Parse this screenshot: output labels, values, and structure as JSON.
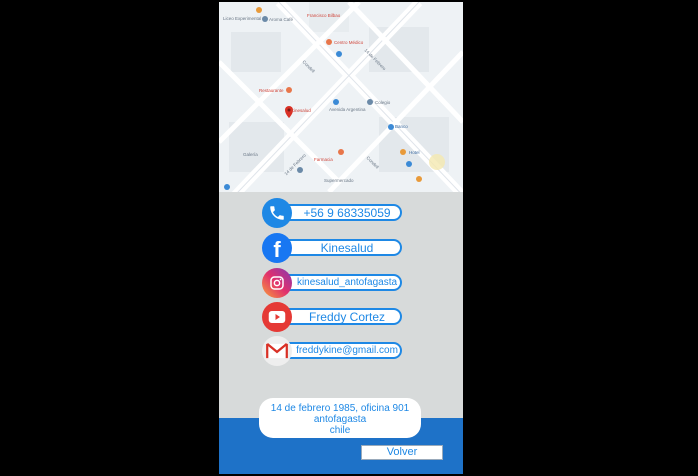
{
  "map": {
    "labels": [
      {
        "text": "Liceo Experimental",
        "tone": "gray"
      },
      {
        "text": "Aroma Café",
        "tone": "gray"
      },
      {
        "text": "Universidad",
        "tone": "gray"
      },
      {
        "text": "Francisco Bilbao",
        "tone": "gray"
      },
      {
        "text": "Centro Médico",
        "tone": "red"
      },
      {
        "text": "Avenida Argentina",
        "tone": "gray"
      },
      {
        "text": "Restaurante",
        "tone": "red"
      },
      {
        "text": "Kinesalud",
        "tone": "red"
      },
      {
        "text": "14 de Febrero",
        "tone": "gray"
      },
      {
        "text": "Colegio",
        "tone": "gray"
      },
      {
        "text": "Banco",
        "tone": "blue"
      },
      {
        "text": "Farmacia",
        "tone": "red"
      },
      {
        "text": "Galería",
        "tone": "gray"
      },
      {
        "text": "Condell",
        "tone": "gray"
      },
      {
        "text": "Hotel",
        "tone": "blue"
      },
      {
        "text": "Supermercado",
        "tone": "gray"
      }
    ]
  },
  "contacts": {
    "phone": "+56 9 68335059",
    "facebook": "Kinesalud",
    "instagram": "kinesalud_antofagasta",
    "youtube": "Freddy Cortez",
    "email": "freddykine@gmail.com"
  },
  "address": {
    "line1": "14 de febrero 1985, oficina 901",
    "line2": "antofagasta",
    "line3": "chile"
  },
  "back_button": "Volver",
  "colors": {
    "accent": "#1e88e5",
    "footer": "#1e72c8",
    "background": "#d7dada"
  }
}
